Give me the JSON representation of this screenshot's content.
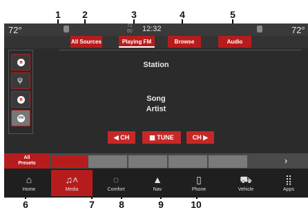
{
  "callouts": {
    "c1": "1",
    "c2": "2",
    "c3": "3",
    "c4": "4",
    "c5": "5",
    "c6": "6",
    "c7": "7",
    "c8": "8",
    "c9": "9",
    "c10": "10"
  },
  "status": {
    "temp_left": "72°",
    "temp_right": "72°",
    "clock": "12:32",
    "center_temp": "72",
    "center_sub": "60"
  },
  "tabs": {
    "all_sources": "All Sources",
    "playing": "Playing FM",
    "browse": "Browse",
    "audio": "Audio"
  },
  "sources": [
    {
      "icon": "bluetooth-icon",
      "glyph": "ʙ"
    },
    {
      "icon": "usb-icon",
      "glyph": "ψ"
    },
    {
      "icon": "bluetooth-icon",
      "glyph": "ʙ"
    },
    {
      "icon": "fm-icon",
      "glyph": "FM"
    }
  ],
  "now_playing": {
    "station": "Station",
    "song": "Song",
    "artist": "Artist"
  },
  "controls": {
    "ch_down": "◀ CH",
    "tune": "▦ TUNE",
    "ch_up": "CH ▶"
  },
  "presets": {
    "all_label": "All\nPresets",
    "next": "›"
  },
  "nav": {
    "home": "Home",
    "media": "Media",
    "comfort": "Comfort",
    "nav": "Nav",
    "phone": "Phone",
    "vehicle": "Vehicle",
    "apps": "Apps"
  },
  "colors": {
    "accent": "#b71c1c",
    "screen_bg": "#2b2b2b"
  }
}
